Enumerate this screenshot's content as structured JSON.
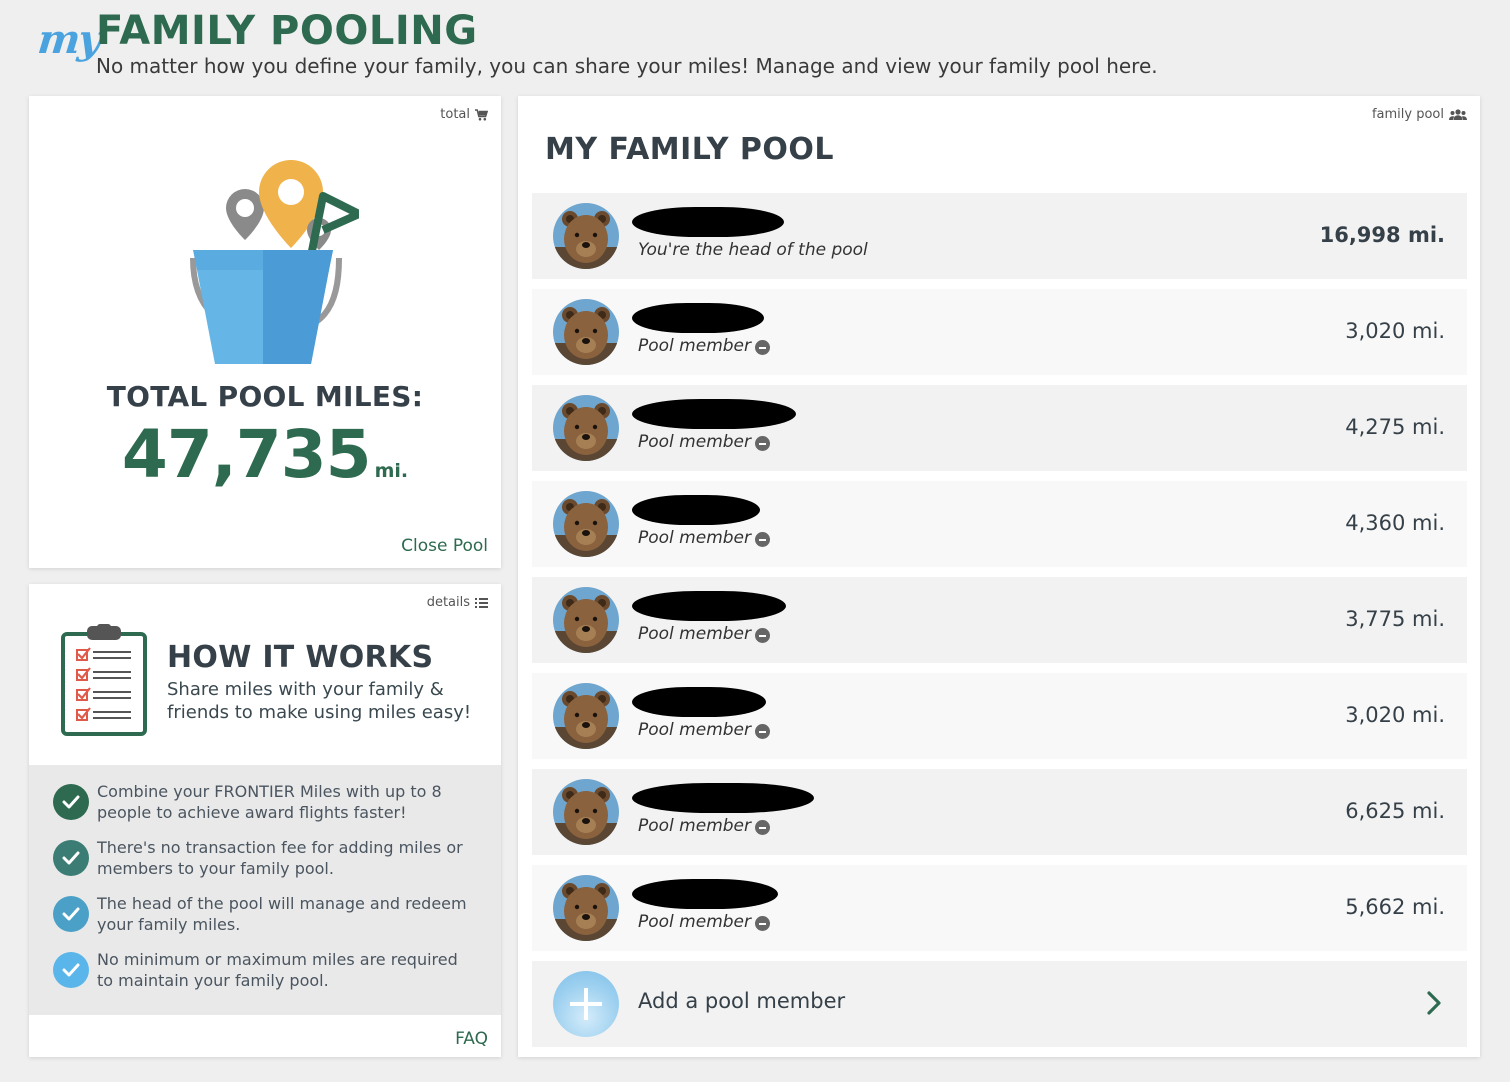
{
  "header": {
    "brand_my": "my",
    "title": "FAMILY POOLING",
    "subtitle": "No matter how you define your family, you can share your miles! Manage and view your family pool here."
  },
  "total_card": {
    "tag": "total",
    "tag_icon": "cart-icon",
    "label": "TOTAL POOL MILES:",
    "value": "47,735",
    "unit": "mi.",
    "close_link": "Close Pool"
  },
  "how_card": {
    "tag": "details",
    "tag_icon": "list-icon",
    "title": "HOW IT WORKS",
    "subtitle": "Share miles with your family & friends to make using miles easy!",
    "benefits": [
      {
        "text": "Combine your FRONTIER Miles with up to 8 people to achieve award flights faster!",
        "color": "#2d6a4f"
      },
      {
        "text": "There's no transaction fee for adding miles or members to your family pool.",
        "color": "#3b7d74"
      },
      {
        "text": "The head of the pool will manage and redeem your family miles.",
        "color": "#4aa0c7"
      },
      {
        "text": "No minimum or maximum miles are required to maintain your family pool.",
        "color": "#5ab5ea"
      }
    ],
    "faq_link": "FAQ"
  },
  "pool_card": {
    "tag": "family pool",
    "tag_icon": "people-icon",
    "title": "MY FAMILY POOL",
    "members": [
      {
        "role": "You're the head of the pool",
        "miles": "16,998 mi.",
        "is_head": true
      },
      {
        "role": "Pool member",
        "miles": "3,020 mi.",
        "is_head": false
      },
      {
        "role": "Pool member",
        "miles": "4,275 mi.",
        "is_head": false
      },
      {
        "role": "Pool member",
        "miles": "4,360 mi.",
        "is_head": false
      },
      {
        "role": "Pool member",
        "miles": "3,775 mi.",
        "is_head": false
      },
      {
        "role": "Pool member",
        "miles": "3,020 mi.",
        "is_head": false
      },
      {
        "role": "Pool member",
        "miles": "6,625 mi.",
        "is_head": false
      },
      {
        "role": "Pool member",
        "miles": "5,662 mi.",
        "is_head": false
      }
    ],
    "add_label": "Add a pool member"
  },
  "colors": {
    "brand_green": "#2d6a4f",
    "brand_blue": "#4aa3df",
    "text_dark": "#354048"
  }
}
